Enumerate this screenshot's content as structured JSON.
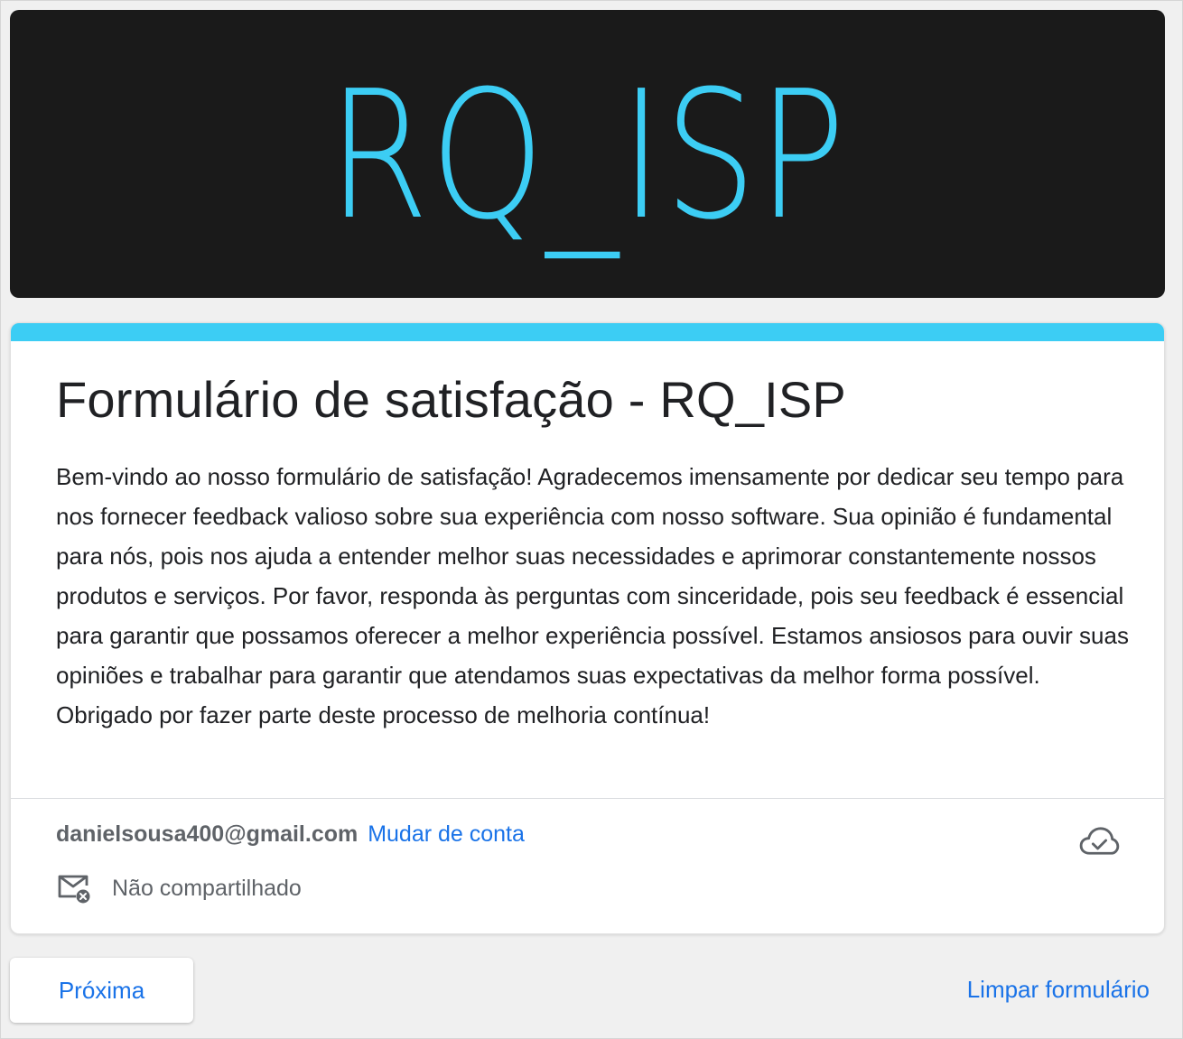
{
  "banner": {
    "logo_text": "RQ_ISP"
  },
  "form": {
    "title": "Formulário de satisfação - RQ_ISP",
    "description": "Bem-vindo ao nosso formulário de satisfação! Agradecemos imensamente por dedicar seu tempo para nos fornecer feedback valioso sobre sua experiência com nosso software. Sua opinião é fundamental para nós, pois nos ajuda a entender melhor suas necessidades e aprimorar constantemente nossos produtos e serviços. Por favor, responda às perguntas com sinceridade, pois seu feedback é essencial para garantir que possamos oferecer a melhor experiência possível. Estamos ansiosos para ouvir suas opiniões e trabalhar para garantir que atendamos suas expectativas da melhor forma possível. Obrigado por fazer parte deste processo de melhoria contínua!"
  },
  "account": {
    "email": "danielsousa400@gmail.com",
    "switch_label": "Mudar de conta",
    "share_status": "Não compartilhado"
  },
  "actions": {
    "next_label": "Próxima",
    "clear_label": "Limpar formulário"
  },
  "icons": {
    "cloud": "cloud-check-icon",
    "mail": "mail-off-icon"
  },
  "colors": {
    "accent": "#3ccdf4",
    "link": "#1a73e8",
    "banner_bg": "#1a1a1a"
  }
}
